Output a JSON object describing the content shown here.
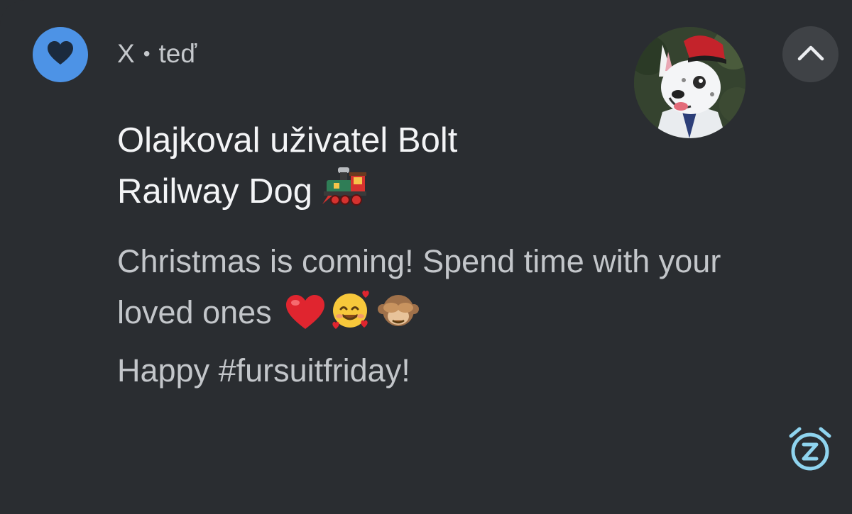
{
  "notification": {
    "app_name": "X",
    "separator": "•",
    "time": "teď",
    "app_icon": "heart-icon",
    "title_line1": "Olajkoval uživatel Bolt",
    "title_line2": "Railway Dog",
    "title_emoji": "locomotive-icon",
    "body_line1": "Christmas is coming! Spend time with your",
    "body_line2": "loved ones",
    "body_emojis": [
      "red-heart-icon",
      "smiling-face-with-hearts-icon",
      "see-no-evil-monkey-icon"
    ],
    "body_line3": "Happy #fursuitfriday!",
    "collapse_icon": "chevron-up-icon",
    "snooze_icon": "snooze-alarm-icon"
  },
  "colors": {
    "background": "#2a2d31",
    "accent": "#4d93e6",
    "snooze": "#8fd4ef"
  }
}
